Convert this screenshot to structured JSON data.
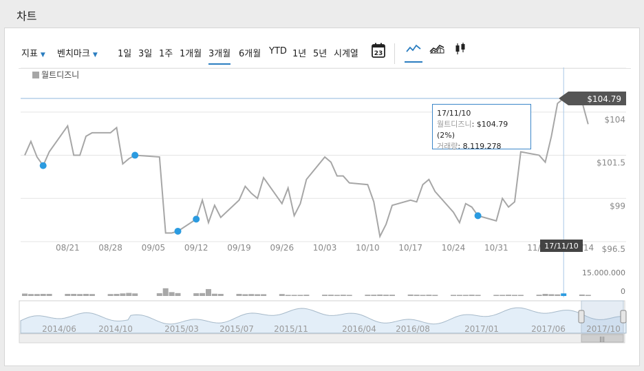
{
  "page": {
    "title": "차트"
  },
  "toolbar": {
    "indicators_label": "지표",
    "benchmark_label": "벤치마크",
    "periods": [
      "1일",
      "3일",
      "1주",
      "1개월",
      "3개월",
      "6개월",
      "YTD",
      "1년",
      "5년",
      "시계열"
    ],
    "active_period": "3개월",
    "calendar_day": "23",
    "chart_types": [
      "line-chart-icon",
      "area-chart-icon",
      "candlestick-chart-icon"
    ],
    "active_chart_type": "line-chart-icon"
  },
  "chart_data": {
    "type": "line",
    "series": [
      {
        "name": "월트디즈니",
        "color": "#a6a6a6",
        "dates": [
          "2017-08-14",
          "2017-08-15",
          "2017-08-16",
          "2017-08-17",
          "2017-08-18",
          "2017-08-21",
          "2017-08-22",
          "2017-08-23",
          "2017-08-24",
          "2017-08-25",
          "2017-08-28",
          "2017-08-29",
          "2017-08-30",
          "2017-08-31",
          "2017-09-01",
          "2017-09-05",
          "2017-09-06",
          "2017-09-07",
          "2017-09-08",
          "2017-09-11",
          "2017-09-12",
          "2017-09-13",
          "2017-09-14",
          "2017-09-15",
          "2017-09-18",
          "2017-09-19",
          "2017-09-20",
          "2017-09-21",
          "2017-09-22",
          "2017-09-25",
          "2017-09-26",
          "2017-09-27",
          "2017-09-28",
          "2017-09-29",
          "2017-10-02",
          "2017-10-03",
          "2017-10-04",
          "2017-10-05",
          "2017-10-06",
          "2017-10-09",
          "2017-10-10",
          "2017-10-11",
          "2017-10-12",
          "2017-10-13",
          "2017-10-16",
          "2017-10-17",
          "2017-10-18",
          "2017-10-19",
          "2017-10-20",
          "2017-10-23",
          "2017-10-24",
          "2017-10-25",
          "2017-10-26",
          "2017-10-27",
          "2017-10-30",
          "2017-10-31",
          "2017-11-01",
          "2017-11-02",
          "2017-11-03",
          "2017-11-06",
          "2017-11-07",
          "2017-11-08",
          "2017-11-09",
          "2017-11-10",
          "2017-11-13",
          "2017-11-14"
        ],
        "values": [
          101.5,
          102.3,
          101.4,
          100.9,
          101.7,
          103.2,
          101.5,
          101.5,
          102.6,
          102.8,
          102.8,
          103.1,
          101.0,
          101.3,
          101.5,
          101.4,
          97.0,
          97.0,
          97.1,
          97.8,
          98.9,
          97.6,
          98.6,
          97.9,
          98.9,
          99.7,
          99.3,
          99.0,
          100.2,
          98.7,
          99.6,
          98.0,
          98.7,
          100.1,
          101.4,
          101.1,
          100.3,
          100.3,
          99.9,
          99.8,
          98.8,
          96.8,
          97.5,
          98.6,
          98.9,
          98.8,
          99.8,
          100.1,
          99.4,
          98.2,
          97.6,
          98.7,
          98.5,
          98.0,
          97.7,
          99.0,
          98.5,
          98.8,
          101.7,
          101.5,
          101.1,
          102.6,
          104.5,
          104.79,
          104.6,
          103.3
        ]
      }
    ],
    "volume_values": [
      1.5,
      1.2,
      1.2,
      1.3,
      1.3,
      1.3,
      1.3,
      1.2,
      1.3,
      1.2,
      1.2,
      1.3,
      1.6,
      1.9,
      1.6,
      1.7,
      4.8,
      2.4,
      1.8,
      1.7,
      1.8,
      4.3,
      1.4,
      1.3,
      1.3,
      1.1,
      1.2,
      1.1,
      1.1,
      1.2,
      0.7,
      0.7,
      0.7,
      0.8,
      0.8,
      0.8,
      0.7,
      0.8,
      0.7,
      0.8,
      0.8,
      0.9,
      0.8,
      0.8,
      0.9,
      0.8,
      0.7,
      0.8,
      0.7,
      0.7,
      0.7,
      0.7,
      0.8,
      0.7,
      0.7,
      0.7,
      0.8,
      0.7,
      0.7,
      0.8,
      1.3,
      1.1,
      1.0,
      1.6,
      0.9,
      0.7
    ],
    "markers_at": [
      "2017-08-17",
      "2017-09-01",
      "2017-09-08",
      "2017-09-11",
      "2017-10-27"
    ],
    "x_tick_labels": [
      "08/21",
      "08/28",
      "09/05",
      "09/12",
      "09/19",
      "09/26",
      "10/03",
      "10/10",
      "10/17",
      "10/24",
      "10/31",
      "11/07",
      "11/14"
    ],
    "y_tick_labels": [
      "$104",
      "$101.5",
      "$99",
      "$96.5"
    ],
    "y_ticks": [
      104,
      101.5,
      99,
      96.5
    ],
    "ylim": [
      96.5,
      104.8
    ],
    "volume_tick_labels": [
      "15.000.000",
      "0"
    ],
    "volume_ylim": [
      0,
      15
    ],
    "current_price_label": "$104.79",
    "current_price": 104.79,
    "crosshair_date_label": "17/11/10",
    "crosshair_date": "2017-11-10",
    "tooltip": {
      "date": "17/11/10",
      "series_label": "월트디즈니",
      "value_text": ": $104.79 (2%)",
      "volume_label": "거래량",
      "volume_text": ": 8.119.278"
    },
    "navigator": {
      "date_labels": [
        "2014/06",
        "2014/10",
        "2015/03",
        "2015/07",
        "2015/11",
        "2016/04",
        "2016/08",
        "2017/01",
        "2017/06",
        "2017/10"
      ],
      "selected_from": "2017-08-14",
      "selected_to": "2017-11-14"
    },
    "grid": true,
    "legend": "top-left"
  },
  "colors": {
    "accent": "#2a7dc0",
    "line": "#a6a6a6",
    "marker": "#2b9be0",
    "price_flag": "#555555",
    "crosshair": "#a9c8e6"
  }
}
